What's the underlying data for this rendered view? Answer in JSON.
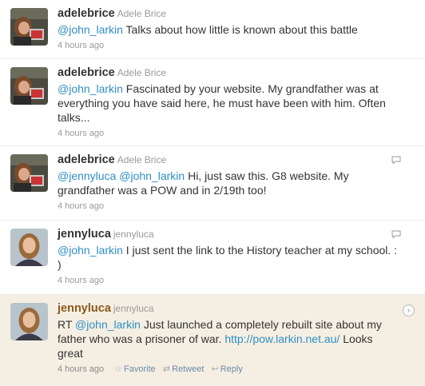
{
  "tweets": [
    {
      "screen_name": "adelebrice",
      "full_name": "Adele Brice",
      "segments": [
        {
          "type": "mention",
          "text": "@john_larkin"
        },
        {
          "type": "text",
          "text": " Talks about how little is known about this battle"
        }
      ],
      "time": "4 hours ago",
      "avatar": "adele-avatar"
    },
    {
      "screen_name": "adelebrice",
      "full_name": "Adele Brice",
      "segments": [
        {
          "type": "mention",
          "text": "@john_larkin"
        },
        {
          "type": "text",
          "text": " Fascinated by your website. My grandfather was at everything you have said here, he must have been with him. Often talks..."
        }
      ],
      "time": "4 hours ago",
      "avatar": "adele-avatar"
    },
    {
      "screen_name": "adelebrice",
      "full_name": "Adele Brice",
      "segments": [
        {
          "type": "mention",
          "text": "@jennyluca"
        },
        {
          "type": "text",
          "text": " "
        },
        {
          "type": "mention",
          "text": "@john_larkin"
        },
        {
          "type": "text",
          "text": " Hi, just saw this. G8 website. My grandfather was a POW and in 2/19th too!"
        }
      ],
      "time": "4 hours ago",
      "avatar": "adele-avatar",
      "has_reply_icon": true
    },
    {
      "screen_name": "jennyluca",
      "full_name": "jennyluca",
      "segments": [
        {
          "type": "mention",
          "text": "@john_larkin"
        },
        {
          "type": "text",
          "text": " I just sent the link to the History teacher at my school. : )"
        }
      ],
      "time": "4 hours ago",
      "avatar": "jenny-avatar",
      "has_reply_icon": true
    },
    {
      "screen_name": "jennyluca",
      "full_name": "jennyluca",
      "segments": [
        {
          "type": "text",
          "text": "RT "
        },
        {
          "type": "mention",
          "text": "@john_larkin"
        },
        {
          "type": "text",
          "text": " Just launched a completely rebuilt site about my father who was a prisoner of war. "
        },
        {
          "type": "link",
          "text": "http://pow.larkin.net.au/"
        },
        {
          "type": "text",
          "text": " Looks great"
        }
      ],
      "time": "4 hours ago",
      "avatar": "jenny-avatar",
      "highlighted": true,
      "actions": {
        "favorite": "Favorite",
        "retweet": "Retweet",
        "reply": "Reply"
      }
    }
  ],
  "icons": {
    "star": "☆",
    "retweet": "⇄",
    "reply": "↩",
    "expand": "›"
  }
}
